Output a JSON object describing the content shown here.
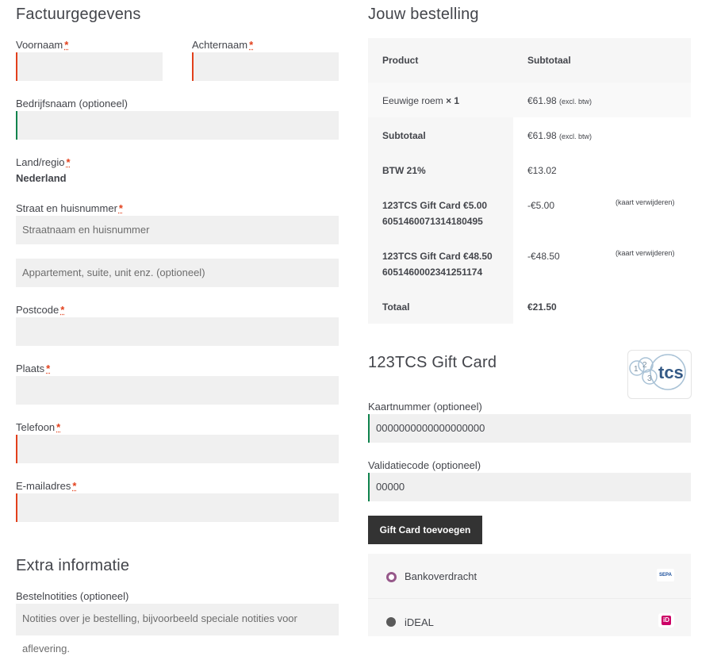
{
  "billing": {
    "title": "Factuurgegevens",
    "first_name_label": "Voornaam",
    "last_name_label": "Achternaam",
    "company_label": "Bedrijfsnaam (optioneel)",
    "country_label": "Land/regio",
    "country_value": "Nederland",
    "street_label": "Straat en huisnummer",
    "street_placeholder": "Straatnaam en huisnummer",
    "apartment_placeholder": "Appartement, suite, unit enz. (optioneel)",
    "postcode_label": "Postcode",
    "city_label": "Plaats",
    "phone_label": "Telefoon",
    "email_label": "E-mailadres",
    "required_mark": "*"
  },
  "extra": {
    "title": "Extra informatie",
    "notes_label": "Bestelnotities (optioneel)",
    "notes_placeholder": "Notities over je bestelling, bijvoorbeeld speciale notities voor aflevering."
  },
  "order": {
    "title": "Jouw bestelling",
    "col_product": "Product",
    "col_subtotal": "Subtotaal",
    "item_name": "Eeuwige roem",
    "item_qty": "× 1",
    "item_price": "€61.98",
    "excl_btw": "(excl. btw)",
    "subtotal_label": "Subtotaal",
    "subtotal_value": "€61.98",
    "tax_label": "BTW 21%",
    "tax_value": "€13.02",
    "gc1_title": "123TCS Gift Card €5.00",
    "gc1_number": "6051460071314180495",
    "gc1_value": "-€5.00",
    "gc2_title": "123TCS Gift Card €48.50",
    "gc2_number": "6051460002341251174",
    "gc2_value": "-€48.50",
    "remove_label": "(kaart verwijderen)",
    "total_label": "Totaal",
    "total_value": "€21.50"
  },
  "giftcard": {
    "title": "123TCS Gift Card",
    "logo_text": "tcs",
    "logo_digits": [
      "1",
      "2",
      "3"
    ],
    "card_label": "Kaartnummer (optioneel)",
    "card_value": "0000000000000000000",
    "code_label": "Validatiecode (optioneel)",
    "code_value": "00000",
    "button_label": "Gift Card toevoegen"
  },
  "payment": {
    "methods": [
      {
        "label": "Bankoverdracht",
        "badge": "SEPA",
        "selected": true
      },
      {
        "label": "iDEAL",
        "badge": "iD",
        "selected": false
      }
    ]
  },
  "colors": {
    "required": "#e2401c",
    "valid": "#0f834d",
    "button_bg": "#333333",
    "radio_selected": "#96588a"
  }
}
